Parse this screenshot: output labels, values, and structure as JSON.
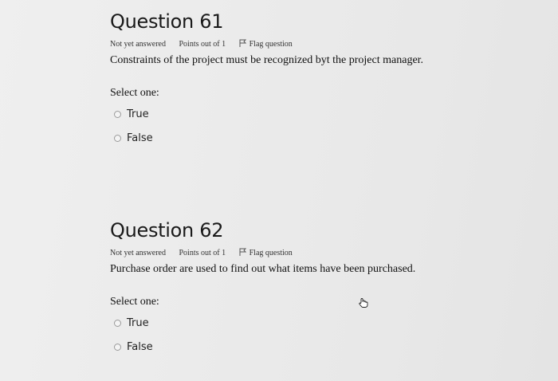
{
  "questions": [
    {
      "title": "Question 61",
      "status": "Not yet answered",
      "points": "Points out of 1",
      "flag_label": "Flag question",
      "text": "Constraints of the project must be recognized byt the project manager.",
      "select_label": "Select one:",
      "options": [
        "True",
        "False"
      ]
    },
    {
      "title": "Question 62",
      "status": "Not yet answered",
      "points": "Points out of 1",
      "flag_label": "Flag question",
      "text": "Purchase order are used to find out what items have been purchased.",
      "select_label": "Select one:",
      "options": [
        "True",
        "False"
      ]
    }
  ],
  "icons": {
    "flag": "flag-icon",
    "radio": "radio-button-icon",
    "cursor": "hand-pointer-icon"
  }
}
